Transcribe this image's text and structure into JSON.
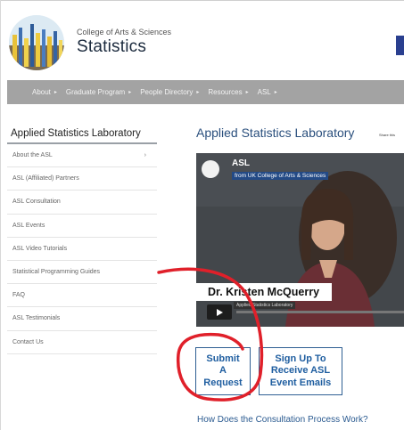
{
  "header": {
    "college": "College of Arts & Sciences",
    "title": "Statistics"
  },
  "nav": {
    "items": [
      "About",
      "Graduate Program",
      "People Directory",
      "Resources",
      "ASL"
    ],
    "caret": "▸"
  },
  "sidebar": {
    "heading": "Applied Statistics Laboratory",
    "items": [
      {
        "label": "About the ASL",
        "arrow": "›"
      },
      {
        "label": "ASL (Affiliated) Partners"
      },
      {
        "label": "ASL Consultation"
      },
      {
        "label": "ASL Events"
      },
      {
        "label": "ASL Video Tutorials"
      },
      {
        "label": "Statistical Programming Guides"
      },
      {
        "label": "FAQ"
      },
      {
        "label": "ASL Testimonials"
      },
      {
        "label": "Contact Us"
      }
    ]
  },
  "main": {
    "title": "Applied Statistics Laboratory",
    "share": "Share this",
    "video": {
      "title": "ASL",
      "from": "from UK College of Arts & Sciences",
      "speaker": "Dr. Kristen McQuerry",
      "speaker_sub": "Applied Statistics Laboratory"
    },
    "buttons": {
      "submit": "Submit\nA\nRequest",
      "signup": "Sign Up To\nReceive ASL\nEvent Emails"
    },
    "consult_link": "How Does the Consultation Process Work?"
  },
  "colors": {
    "nav_bg": "#a3a3a3",
    "title_blue": "#2a4f7d",
    "button_blue": "#1f5ea0",
    "annotation_red": "#e0202a"
  },
  "icons": {
    "logo": "college-logo-icon",
    "play": "play-icon"
  }
}
